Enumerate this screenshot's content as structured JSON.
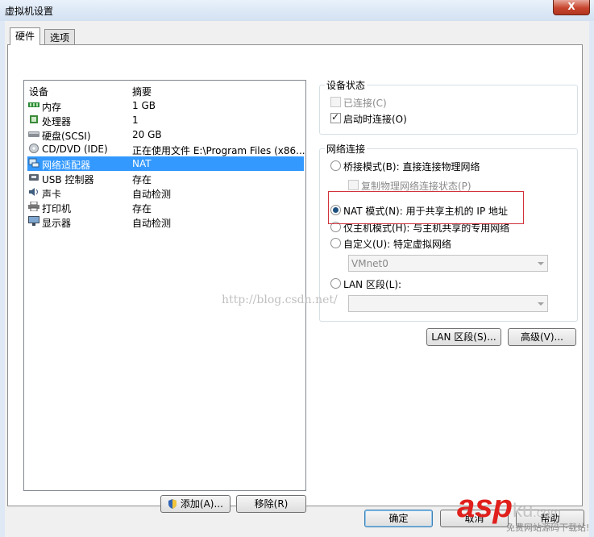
{
  "window": {
    "title": "虚拟机设置",
    "close_glyph": "X"
  },
  "tabs": [
    {
      "label": "硬件",
      "active": true
    },
    {
      "label": "选项",
      "active": false
    }
  ],
  "device_list": {
    "columns": {
      "device": "设备",
      "summary": "摘要"
    },
    "rows": [
      {
        "icon": "memory-icon",
        "name": "内存",
        "summary": "1 GB"
      },
      {
        "icon": "processor-icon",
        "name": "处理器",
        "summary": "1"
      },
      {
        "icon": "harddisk-icon",
        "name": "硬盘(SCSI)",
        "summary": "20 GB"
      },
      {
        "icon": "cd-dvd-icon",
        "name": "CD/DVD (IDE)",
        "summary": "正在使用文件 E:\\Program Files (x86..."
      },
      {
        "icon": "network-adapter-icon",
        "name": "网络适配器",
        "summary": "NAT",
        "selected": true
      },
      {
        "icon": "usb-icon",
        "name": "USB 控制器",
        "summary": "存在"
      },
      {
        "icon": "sound-card-icon",
        "name": "声卡",
        "summary": "自动检测"
      },
      {
        "icon": "printer-icon",
        "name": "打印机",
        "summary": "存在"
      },
      {
        "icon": "display-icon",
        "name": "显示器",
        "summary": "自动检测"
      }
    ],
    "add_button": "添加(A)...",
    "remove_button": "移除(R)"
  },
  "device_status": {
    "title": "设备状态",
    "connected": {
      "label": "已连接(C)",
      "checked": false,
      "enabled": false
    },
    "connect_at_power_on": {
      "label": "启动时连接(O)",
      "checked": true,
      "enabled": true
    }
  },
  "network_connection": {
    "title": "网络连接",
    "options": {
      "bridged": {
        "label": "桥接模式(B): 直接连接物理网络",
        "selected": false
      },
      "replicate": {
        "label": "复制物理网络连接状态(P)",
        "checked": false,
        "enabled": false
      },
      "nat": {
        "label": "NAT 模式(N): 用于共享主机的 IP 地址",
        "selected": true
      },
      "host_only": {
        "label": "仅主机模式(H): 与主机共享的专用网络",
        "selected": false
      },
      "custom": {
        "label": "自定义(U): 特定虚拟网络",
        "selected": false
      },
      "lan_segment": {
        "label": "LAN 区段(L):",
        "selected": false
      }
    },
    "custom_network_value": "VMnet0",
    "lan_segment_value": "",
    "lan_segments_button": "LAN 区段(S)...",
    "advanced_button": "高级(V)..."
  },
  "footer": {
    "ok_button": "确定",
    "cancel_button": "取消",
    "help_button": "帮助"
  },
  "watermark": "http://blog.csdn.net/",
  "logo": {
    "main": "asp",
    "ku": "ku",
    "com": ".com",
    "subtitle": "免费网站源码下载站!"
  },
  "colors": {
    "selection": "#3399ff",
    "highlight_border": "#d2323a",
    "logo_red": "#e0201c"
  }
}
